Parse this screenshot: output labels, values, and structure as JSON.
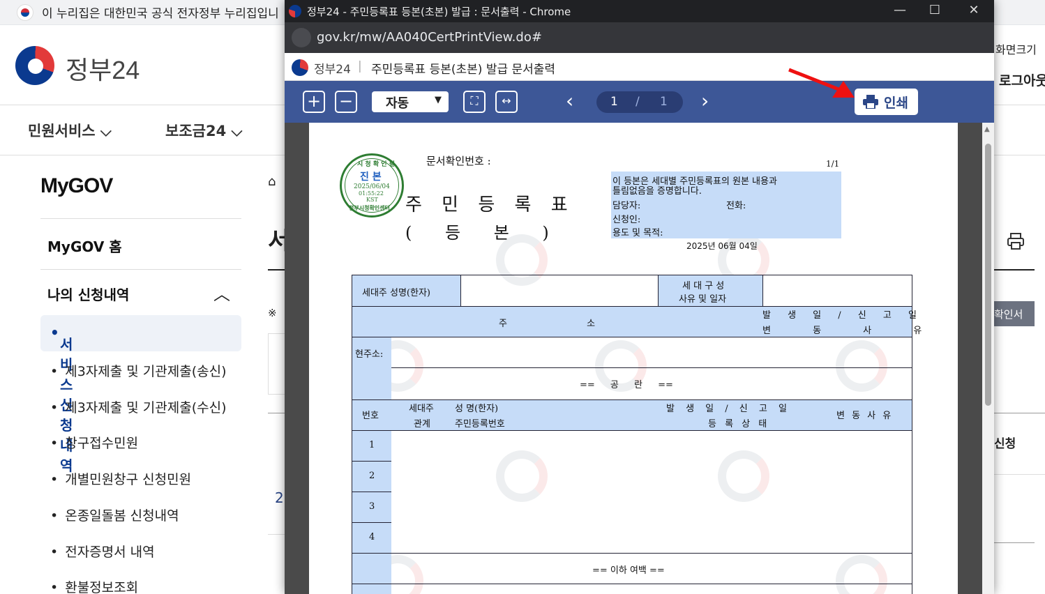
{
  "banner": {
    "text": "이 누리집은 대한민국 공식 전자정부 누리집입니"
  },
  "site": {
    "logo_text": "정부24"
  },
  "gnb": {
    "item1": "민원서비스",
    "item2": "보조금24"
  },
  "sidebar": {
    "title": "MyGOV",
    "home": "MyGOV 홈",
    "section": "나의 신청내역",
    "active": "서비스 신청내역",
    "items": [
      "제3자제출 및 기관제출(송신)",
      "제3자제출 및 기관제출(수신)",
      "창구접수민원",
      "개별민원창구 신청민원",
      "온종일돌봄 신청내역",
      "전자증명서 내역",
      "환불정보조회"
    ]
  },
  "bg_right": {
    "screen_zoom": "화면크기",
    "logout": "로그아웃",
    "confirm_btn": "확인서",
    "apply": "신청",
    "mark": "※",
    "year_peek": "2",
    "title_peek": "서"
  },
  "popup": {
    "title": "정부24 - 주민등록표 등본(초본) 발급 : 문서출력 - Chrome",
    "url": "gov.kr/mw/AA040CertPrintView.do#",
    "brand": "정부24",
    "doc_title": "주민등록표 등본(초본) 발급 문서출력",
    "zoom": "자동",
    "page_current": "1",
    "page_sep": "/",
    "page_total": "1",
    "print_label": "인쇄"
  },
  "document": {
    "confirm_no_label": "문서확인번호 :",
    "page_count": "1/1",
    "title": "주 민 등 록 표",
    "subtitle": "( 등 본 )",
    "stamp": {
      "top": "시 청 확 인 필",
      "mid": "진 본",
      "date": "2025/06/04",
      "time": "01:55:22",
      "tz": "KST",
      "bottom": "정부시청확인센터"
    },
    "notice_line1": "이 등본은 세대별 주민등록표의 원본 내용과",
    "notice_line2": "틀림없음을 증명합니다.",
    "manager": "담당자:",
    "phone": "전화:",
    "applicant": "신청인:",
    "purpose": "용도 및 목적:",
    "date": "2025년 06월 04일",
    "table": {
      "head_name": "세대주 성명(한자)",
      "head_comp1": "세 대 구 성",
      "head_comp2": "사유 및 일자",
      "addr": "주 소",
      "addr_date1": "발 생 일 / 신 고 일",
      "addr_date2": "변 동 사 유",
      "current_addr": "현주소:",
      "blank": "== 공 란 ==",
      "col_no": "번호",
      "col_rel1": "세대주",
      "col_rel2": "관계",
      "col_name1": "성 명(한자)",
      "col_name2": "주민등록번호",
      "col_date1": "발 생 일 / 신 고 일",
      "col_date2": "등 록 상 태",
      "col_reason": "변 동 사 유",
      "rows": [
        "1",
        "2",
        "3",
        "4"
      ],
      "end": "== 이하 여백 =="
    }
  },
  "colors": {
    "toolbar": "#3d5797",
    "highlight": "#c6dcf8",
    "arrow": "#e11"
  }
}
